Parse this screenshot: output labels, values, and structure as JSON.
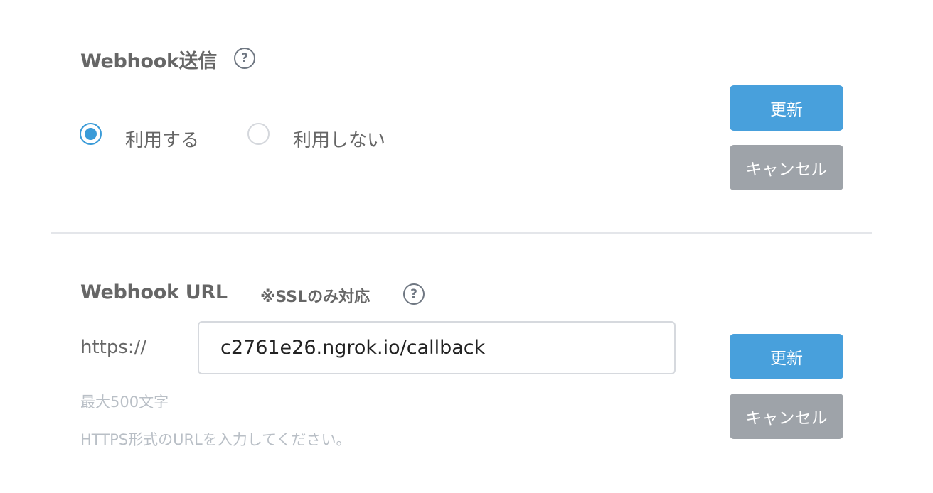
{
  "webhook_send": {
    "title": "Webhook送信",
    "help_icon_glyph": "?",
    "options": [
      {
        "label": "利用する",
        "checked": true
      },
      {
        "label": "利用しない",
        "checked": false
      }
    ],
    "update_label": "更新",
    "cancel_label": "キャンセル"
  },
  "webhook_url": {
    "title": "Webhook URL",
    "note": "※SSLのみ対応",
    "help_icon_glyph": "?",
    "prefix": "https://",
    "input_value": "c2761e26.ngrok.io/callback",
    "max_length_hint": "最大500文字",
    "format_hint": "HTTPS形式のURLを入力してください。",
    "update_label": "更新",
    "cancel_label": "キャンセル"
  },
  "colors": {
    "primary": "#48a0dc",
    "secondary": "#9ea3a9",
    "radio_checked": "#3a9bd8",
    "hint_text": "#b9bfc6"
  }
}
